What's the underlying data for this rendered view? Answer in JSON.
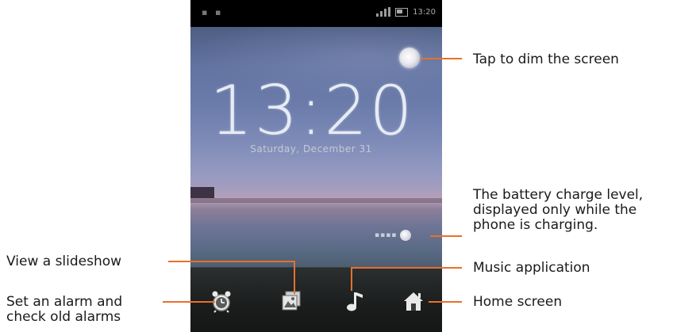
{
  "phone": {
    "clock_time": "13:20",
    "date_text": "Saturday, December 31",
    "status_time": "13:20"
  },
  "callouts": {
    "dim_screen": "Tap to dim the screen",
    "battery_line1": "The battery charge level,",
    "battery_line2": "displayed only while the",
    "battery_line3": "phone is charging.",
    "music": "Music application",
    "home": "Home screen",
    "slideshow": "View a slideshow",
    "alarm_line1": "Set an alarm and",
    "alarm_line2": "check old alarms"
  },
  "dock": {
    "icons": [
      "alarm-clock-icon",
      "slideshow-icon",
      "music-note-icon",
      "home-icon"
    ]
  },
  "colors": {
    "callout_line": "#e8702a",
    "dock_background": "#1b1d1d",
    "status_bar": "#000000"
  }
}
